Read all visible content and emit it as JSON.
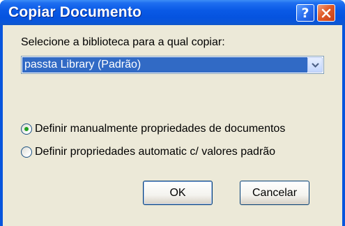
{
  "window": {
    "title": "Copiar Documento",
    "help_glyph": "?",
    "close_icon": "close-icon",
    "help_icon": "help-icon"
  },
  "dialog": {
    "prompt": "Selecione a biblioteca para a qual copiar:",
    "library_select": {
      "selected": "passta Library  (Padrão)"
    },
    "options": [
      {
        "label": "Definir manualmente propriedades de documentos",
        "checked": true
      },
      {
        "label": "Definir propriedades automatic c/ valores padrão",
        "checked": false
      }
    ],
    "buttons": {
      "ok": "OK",
      "cancel": "Cancelar"
    }
  },
  "colors": {
    "titlebar": "#0a5ae6",
    "selection": "#316ac5",
    "dialog_face": "#ece9d8",
    "radio_dot": "#21a121"
  }
}
